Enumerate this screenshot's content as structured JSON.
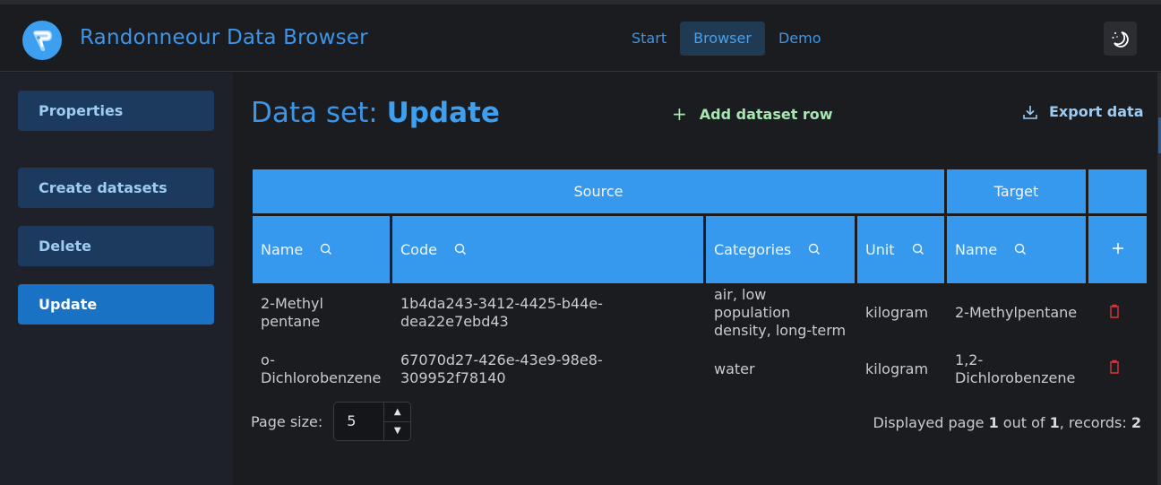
{
  "header": {
    "app_title": "Randonneour Data Browser",
    "nav": [
      {
        "label": "Start",
        "active": false
      },
      {
        "label": "Browser",
        "active": true
      },
      {
        "label": "Demo",
        "active": false
      }
    ],
    "theme_toggle_icon": "moon-stars-icon"
  },
  "sidebar": {
    "items": [
      {
        "label": "Properties",
        "active": false
      },
      {
        "label": "Create datasets",
        "active": false
      },
      {
        "label": "Delete",
        "active": false
      },
      {
        "label": "Update",
        "active": true
      }
    ]
  },
  "main": {
    "title_prefix": "Data set:",
    "title_name": "Update",
    "add_row_label": "Add dataset row",
    "export_label": "Export data",
    "table": {
      "groups": [
        {
          "label": "Source"
        },
        {
          "label": "Target"
        },
        {
          "label": ""
        }
      ],
      "columns": [
        {
          "label": "Name"
        },
        {
          "label": "Code"
        },
        {
          "label": "Categories"
        },
        {
          "label": "Unit"
        },
        {
          "label": "Name"
        }
      ],
      "rows": [
        {
          "source_name": "2-Methyl pentane",
          "code": "1b4da243-3412-4425-b44e-dea22e7ebd43",
          "categories": "air, low population density, long-term",
          "unit": "kilogram",
          "target_name": "2-Methylpentane"
        },
        {
          "source_name": "o-Dichlorobenzene",
          "code": "67070d27-426e-43e9-98e8-309952f78140",
          "categories": "water",
          "unit": "kilogram",
          "target_name": "1,2-Dichlorobenzene"
        }
      ]
    },
    "pager": {
      "label": "Page size:",
      "page_size": "5",
      "info_prefix": "Displayed page",
      "current_page": "1",
      "info_mid": "out of",
      "total_pages": "1",
      "info_records": ", records:",
      "records": "2"
    }
  },
  "colors": {
    "accent": "#3699ed",
    "active_sidebar": "#1a72c4",
    "add_row": "#a6e6b0",
    "delete": "#d9363e"
  }
}
